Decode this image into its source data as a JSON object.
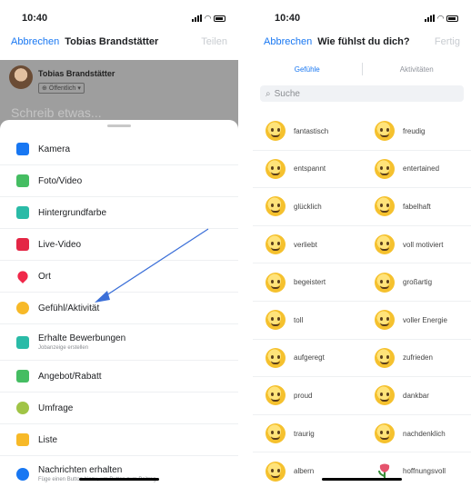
{
  "left": {
    "status": {
      "time": "10:40"
    },
    "nav": {
      "cancel": "Abbrechen",
      "title": "Tobias Brandstätter",
      "right": "Teilen"
    },
    "composer": {
      "author": "Tobias Brandstätter",
      "privacy": "Öffentlich",
      "placeholder": "Schreib etwas..."
    },
    "menu": [
      {
        "label": "Kamera",
        "icon": "camera-icon",
        "color": "#1877f2"
      },
      {
        "label": "Foto/Video",
        "icon": "photo-icon",
        "color": "#45bd62"
      },
      {
        "label": "Hintergrundfarbe",
        "icon": "aa-icon",
        "color": "#2abba7"
      },
      {
        "label": "Live-Video",
        "icon": "live-video-icon",
        "color": "#e42645"
      },
      {
        "label": "Ort",
        "icon": "location-pin-icon",
        "color": "#f02849"
      },
      {
        "label": "Gefühl/Aktivität",
        "icon": "feeling-icon",
        "color": "#f7b928"
      },
      {
        "label": "Erhalte Bewerbungen",
        "sub": "Jobanzeige erstellen",
        "icon": "briefcase-icon",
        "color": "#2abba7"
      },
      {
        "label": "Angebot/Rabatt",
        "icon": "tag-icon",
        "color": "#45bd62"
      },
      {
        "label": "Umfrage",
        "icon": "poll-icon",
        "color": "#a0c446"
      },
      {
        "label": "Liste",
        "icon": "list-icon",
        "color": "#f7b928"
      },
      {
        "label": "Nachrichten erhalten",
        "sub": "Füge einen Button hinzu, um Button zum Beitrag",
        "icon": "messenger-icon",
        "color": "#1877f2"
      }
    ]
  },
  "right": {
    "status": {
      "time": "10:40"
    },
    "nav": {
      "cancel": "Abbrechen",
      "title": "Wie fühlst du dich?",
      "right": "Fertig"
    },
    "tabs": [
      "Gefühle",
      "Aktivitäten"
    ],
    "search_placeholder": "Suche",
    "feelings": [
      [
        "fantastisch",
        "freudig"
      ],
      [
        "entspannt",
        "entertained"
      ],
      [
        "glücklich",
        "fabelhaft"
      ],
      [
        "verliebt",
        "voll motiviert"
      ],
      [
        "begeistert",
        "großartig"
      ],
      [
        "toll",
        "voller Energie"
      ],
      [
        "aufgeregt",
        "zufrieden"
      ],
      [
        "proud",
        "dankbar"
      ],
      [
        "traurig",
        "nachdenklich"
      ],
      [
        "albern",
        "hoffnungsvoll"
      ]
    ]
  },
  "colors": {
    "accent": "#1877f2",
    "arrow": "#3b6fd8"
  }
}
